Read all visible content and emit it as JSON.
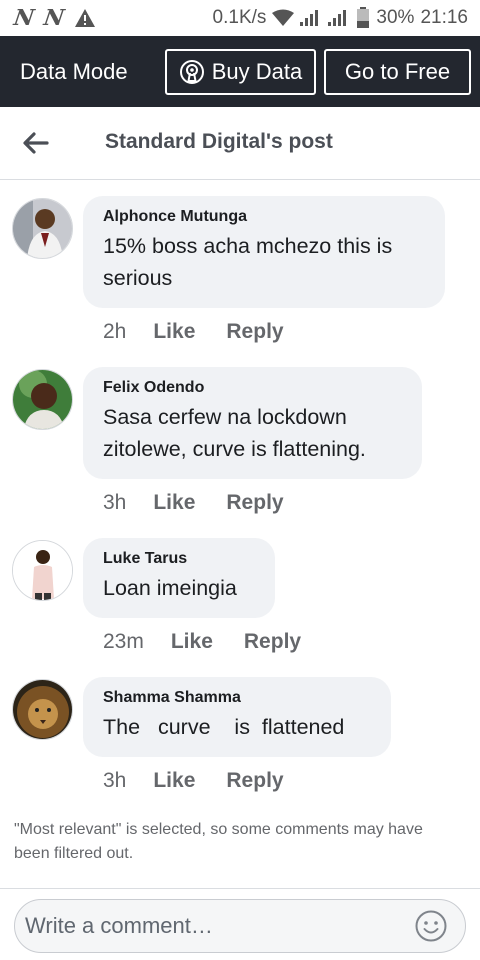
{
  "status_bar": {
    "notif1": "N",
    "notif2": "N",
    "speed": "0.1K/s",
    "battery": "30%",
    "time": "21:16"
  },
  "data_bar": {
    "mode_label": "Data Mode",
    "buy_label": "Buy Data",
    "free_label": "Go to Free"
  },
  "header": {
    "title": "Standard Digital's post"
  },
  "comments": [
    {
      "author": "Alphonce Mutunga",
      "text": "15% boss acha mchezo this is serious",
      "time": "2h",
      "like": "Like",
      "reply": "Reply"
    },
    {
      "author": "Felix Odendo",
      "text": "Sasa cerfew na lockdown zitolewe, curve is flattening.",
      "time": "3h",
      "like": "Like",
      "reply": "Reply"
    },
    {
      "author": "Luke Tarus",
      "text": "Loan imeingia",
      "time": "23m",
      "like": "Like",
      "reply": "Reply"
    },
    {
      "author": "Shamma Shamma",
      "text": "The   curve    is  flattened",
      "time": "3h",
      "like": "Like",
      "reply": "Reply"
    }
  ],
  "note": "\"Most relevant\" is selected, so some comments may have been filtered out.",
  "composer": {
    "placeholder": "Write a comment…"
  },
  "colors": {
    "data_bar_bg": "#23272f",
    "bubble_bg": "#f0f2f5",
    "meta_text": "#65676b"
  },
  "icons": [
    "warning-icon",
    "wifi-icon",
    "signal-icon",
    "battery-icon",
    "broadcast-icon",
    "back-arrow-icon",
    "emoji-icon"
  ]
}
